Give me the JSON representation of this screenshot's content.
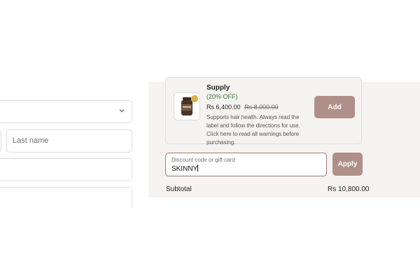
{
  "form": {
    "last_name_placeholder": "Last name"
  },
  "upsell": {
    "title": "Supply",
    "discount": "(20% OFF)",
    "price": "Rs 6,400.00",
    "compare_price": "Rs 8,000.00",
    "note": "Supports hair health. Always read the label and follow the directions for use. Click here to read all warnings before purchasing.",
    "add_label": "Add"
  },
  "discount": {
    "label": "Discount code or gift card",
    "value": "SKINNY",
    "apply_label": "Apply"
  },
  "summary": {
    "subtotal_label": "Subtotal",
    "subtotal_value": "Rs 10,800.00"
  },
  "colors": {
    "accent": "#b08f89",
    "discount_green": "#2f7a34",
    "panel_bg": "#f5f3f2"
  },
  "icons": {
    "country_select": "chevron-down-icon",
    "product": "product-image"
  }
}
